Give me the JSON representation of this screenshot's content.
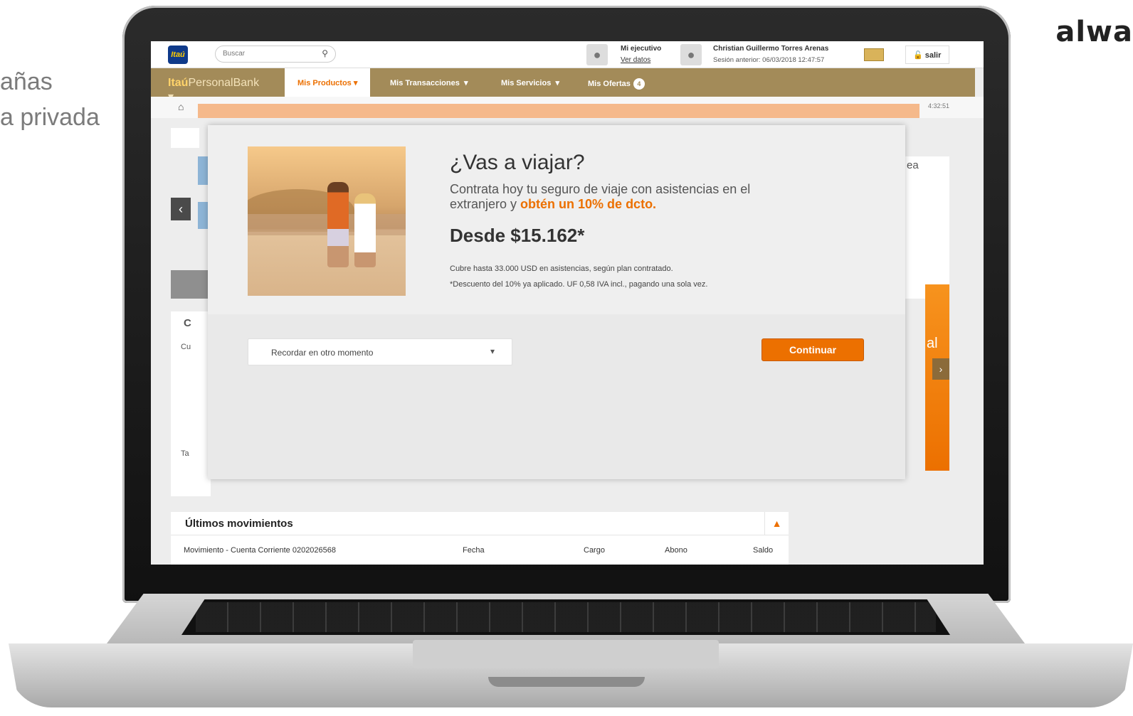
{
  "side_text": {
    "line1": "añas",
    "line2": "a privada"
  },
  "brand_mark": "alwa",
  "header": {
    "logo_text": "Itaú",
    "search_placeholder": "Buscar",
    "search_icon": "search-icon",
    "executive_title": "Mi ejecutivo",
    "executive_link": "Ver datos",
    "user_name": "Christian Guillermo Torres Arenas",
    "user_session": "Sesión anterior: 06/03/2018 12:47:57",
    "logout_label": "salir"
  },
  "nav": {
    "brand_bold": "Itaú",
    "brand_light": "PersonalBank",
    "items": [
      {
        "label": "Mis Productos"
      },
      {
        "label": "Mis Transacciones"
      },
      {
        "label": "Mis Servicios"
      },
      {
        "label": "Mis Ofertas",
        "badge": "4"
      }
    ]
  },
  "subbar": {
    "time": "4:32:51"
  },
  "modal": {
    "title": "¿Vas a viajar?",
    "desc_part1": "Contrata hoy tu seguro de viaje con asistencias en el extranjero y ",
    "desc_highlight": "obtén un 10% de dcto.",
    "price": "Desde $15.162*",
    "note1": "Cubre hasta 33.000 USD en asistencias, según plan contratado.",
    "note2": "*Descuento del 10% ya aplicado. UF 0,58 IVA incl., pagando una sola vez.",
    "remind_option": "Recordar en otro momento",
    "continue_label": "Continuar"
  },
  "movements": {
    "title": "Últimos movimientos",
    "columns": [
      "Movimiento - Cuenta Corriente 0202026568",
      "Fecha",
      "Cargo",
      "Abono",
      "Saldo"
    ]
  },
  "ghost": {
    "c": "C",
    "cu": "Cu",
    "ta": "Ta",
    "ea": "ea",
    "al": "al"
  },
  "colors": {
    "accent": "#ec7000",
    "nav": "#a38b59",
    "peach": "#f5b98b"
  }
}
